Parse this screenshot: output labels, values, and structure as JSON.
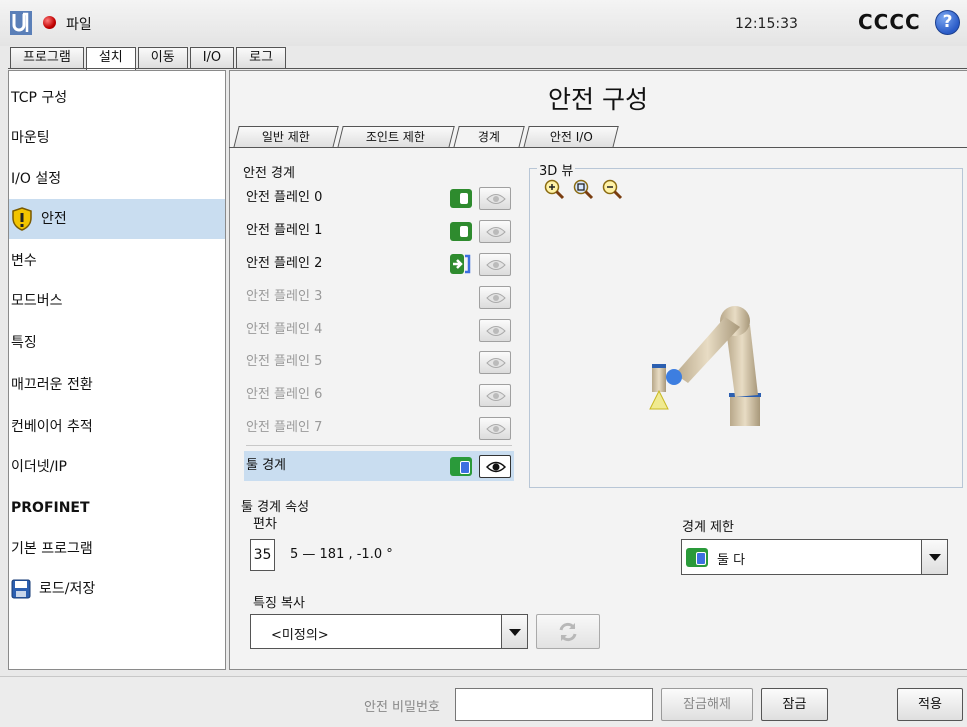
{
  "header": {
    "file_menu": "파일",
    "clock": "12:15:33",
    "robot_name": "CCCC",
    "help_glyph": "?"
  },
  "top_tabs": [
    "프로그램",
    "설치",
    "이동",
    "I/O",
    "로그"
  ],
  "sidebar": {
    "items": [
      "TCP 구성",
      "마운팅",
      "I/O 설정",
      "안전",
      "변수",
      "모드버스",
      "특징",
      "매끄러운 전환",
      "컨베이어 추적",
      "이더넷/IP",
      "PROFINET",
      "기본 프로그램",
      "로드/저장"
    ]
  },
  "main": {
    "title": "안전 구성",
    "tabs": [
      "일반 제한",
      "조인트 제한",
      "경계",
      "안전 I/O"
    ],
    "boundaries": {
      "title": "안전 경계",
      "planes": [
        "안전 플레인 0",
        "안전 플레인 1",
        "안전 플레인 2",
        "안전 플레인 3",
        "안전 플레인 4",
        "안전 플레인 5",
        "안전 플레인 6",
        "안전 플레인 7"
      ],
      "tool_boundary": "툴 경계"
    },
    "view3d": {
      "title": "3D 뷰"
    },
    "props": {
      "title": "툴 경계 속성",
      "deviation_label": "편차",
      "deviation_value": "35",
      "deviation_range": "5 — 181 , -1.0 °",
      "limit_label": "경계 제한",
      "limit_value": "둘 다",
      "copy_label": "특징 복사",
      "copy_value": "<미정의>"
    }
  },
  "footer": {
    "password_label": "안전 비밀번호",
    "unlock": "잠금해제",
    "lock": "잠금",
    "apply": "적용"
  },
  "colors": {
    "accent_select": "#c9ddf0",
    "toggle_green": "#2e8b2e",
    "toggle_blue": "#3d6fe0"
  }
}
